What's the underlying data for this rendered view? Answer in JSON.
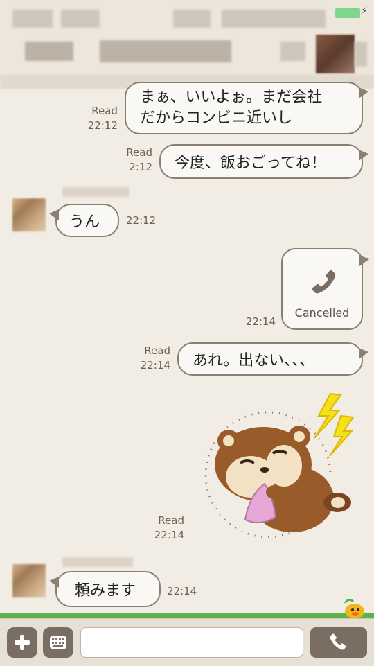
{
  "messages": [
    {
      "side": "right",
      "read": "Read",
      "time": "22:12",
      "text_line1": "まぁ、いいよぉ。まだ会社",
      "text_line2": "だからコンビニ近いし"
    },
    {
      "side": "right",
      "read": "Read",
      "time": "2:12",
      "text": "今度、飯おごってね！"
    },
    {
      "side": "left",
      "time": "22:12",
      "text": "うん"
    },
    {
      "side": "right",
      "type": "call",
      "time": "22:14",
      "call_status": "Cancelled",
      "icon": "phone-icon"
    },
    {
      "side": "right",
      "read": "Read",
      "time": "22:14",
      "text": "あれ。出ない、、、"
    },
    {
      "side": "right",
      "type": "sticker",
      "read": "Read",
      "time": "22:14",
      "sticker": "chipmunk-frustrated-sticker"
    },
    {
      "side": "left",
      "time": "22:14",
      "text": "頼みます"
    }
  ],
  "input": {
    "placeholder": ""
  },
  "icons": {
    "plus": "plus-icon",
    "keyboard": "keyboard-icon",
    "call": "phone-icon"
  },
  "colors": {
    "bubble_border": "#8b7f72",
    "background": "#f2ede4",
    "button": "#7a6d62",
    "grass": "#5eb24c"
  }
}
